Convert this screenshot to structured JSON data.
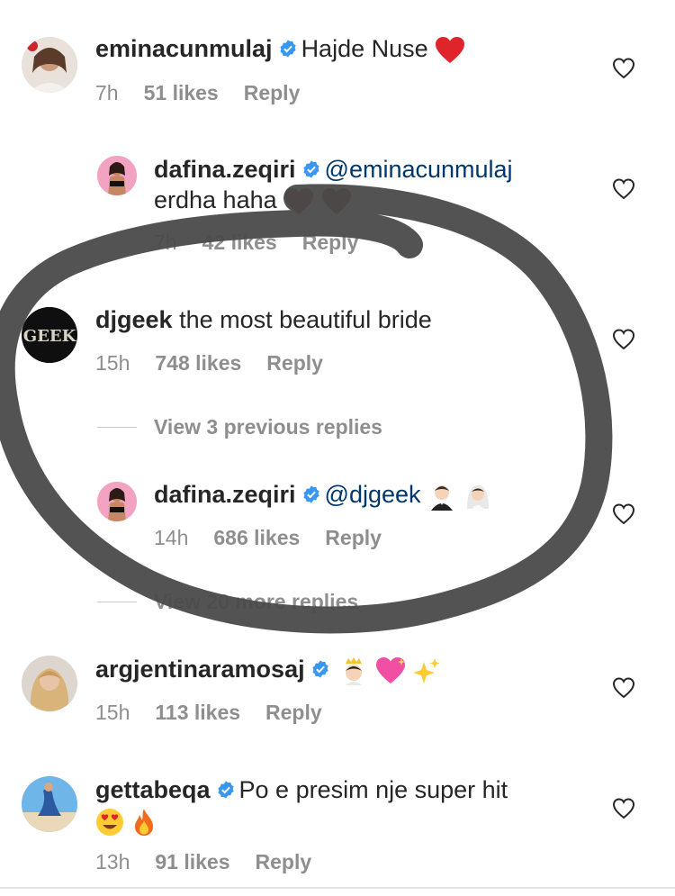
{
  "comments": [
    {
      "username": "eminacunmulaj",
      "verified": true,
      "text": "Hajde Nuse",
      "emoji": [
        "red-heart"
      ],
      "time": "7h",
      "likes": "51 likes",
      "reply": "Reply"
    },
    {
      "username": "dafina.zeqiri",
      "verified": true,
      "mention": "@eminacunmulaj",
      "text_line2": "erdha haha",
      "emoji": [
        "dark-heart",
        "dark-heart"
      ],
      "time": "7h",
      "likes": "42 likes",
      "reply": "Reply"
    },
    {
      "username": "djgeek",
      "verified": false,
      "text": "the most beautiful bride",
      "avatar_text": "GEEK",
      "time": "15h",
      "likes": "748 likes",
      "reply": "Reply"
    },
    {
      "username": "dafina.zeqiri",
      "verified": true,
      "mention": "@djgeek",
      "emoji": [
        "groom",
        "bride"
      ],
      "time": "14h",
      "likes": "686 likes",
      "reply": "Reply"
    },
    {
      "username": "argjentinaramosaj",
      "verified": true,
      "emoji": [
        "princess",
        "sparkling-heart",
        "sparkles"
      ],
      "time": "15h",
      "likes": "113 likes",
      "reply": "Reply"
    },
    {
      "username": "gettabeqa",
      "verified": true,
      "text": "Po e presim nje super hit",
      "emoji": [
        "heart-eyes",
        "fire"
      ],
      "time": "13h",
      "likes": "91 likes",
      "reply": "Reply"
    }
  ],
  "view_previous": "View 3 previous replies",
  "view_more": "View 20 more replies",
  "colors": {
    "verified_blue": "#3897f0",
    "mention": "#00376b",
    "meta_gray": "#8e8e8e",
    "scribble": "#4a4a4a"
  }
}
